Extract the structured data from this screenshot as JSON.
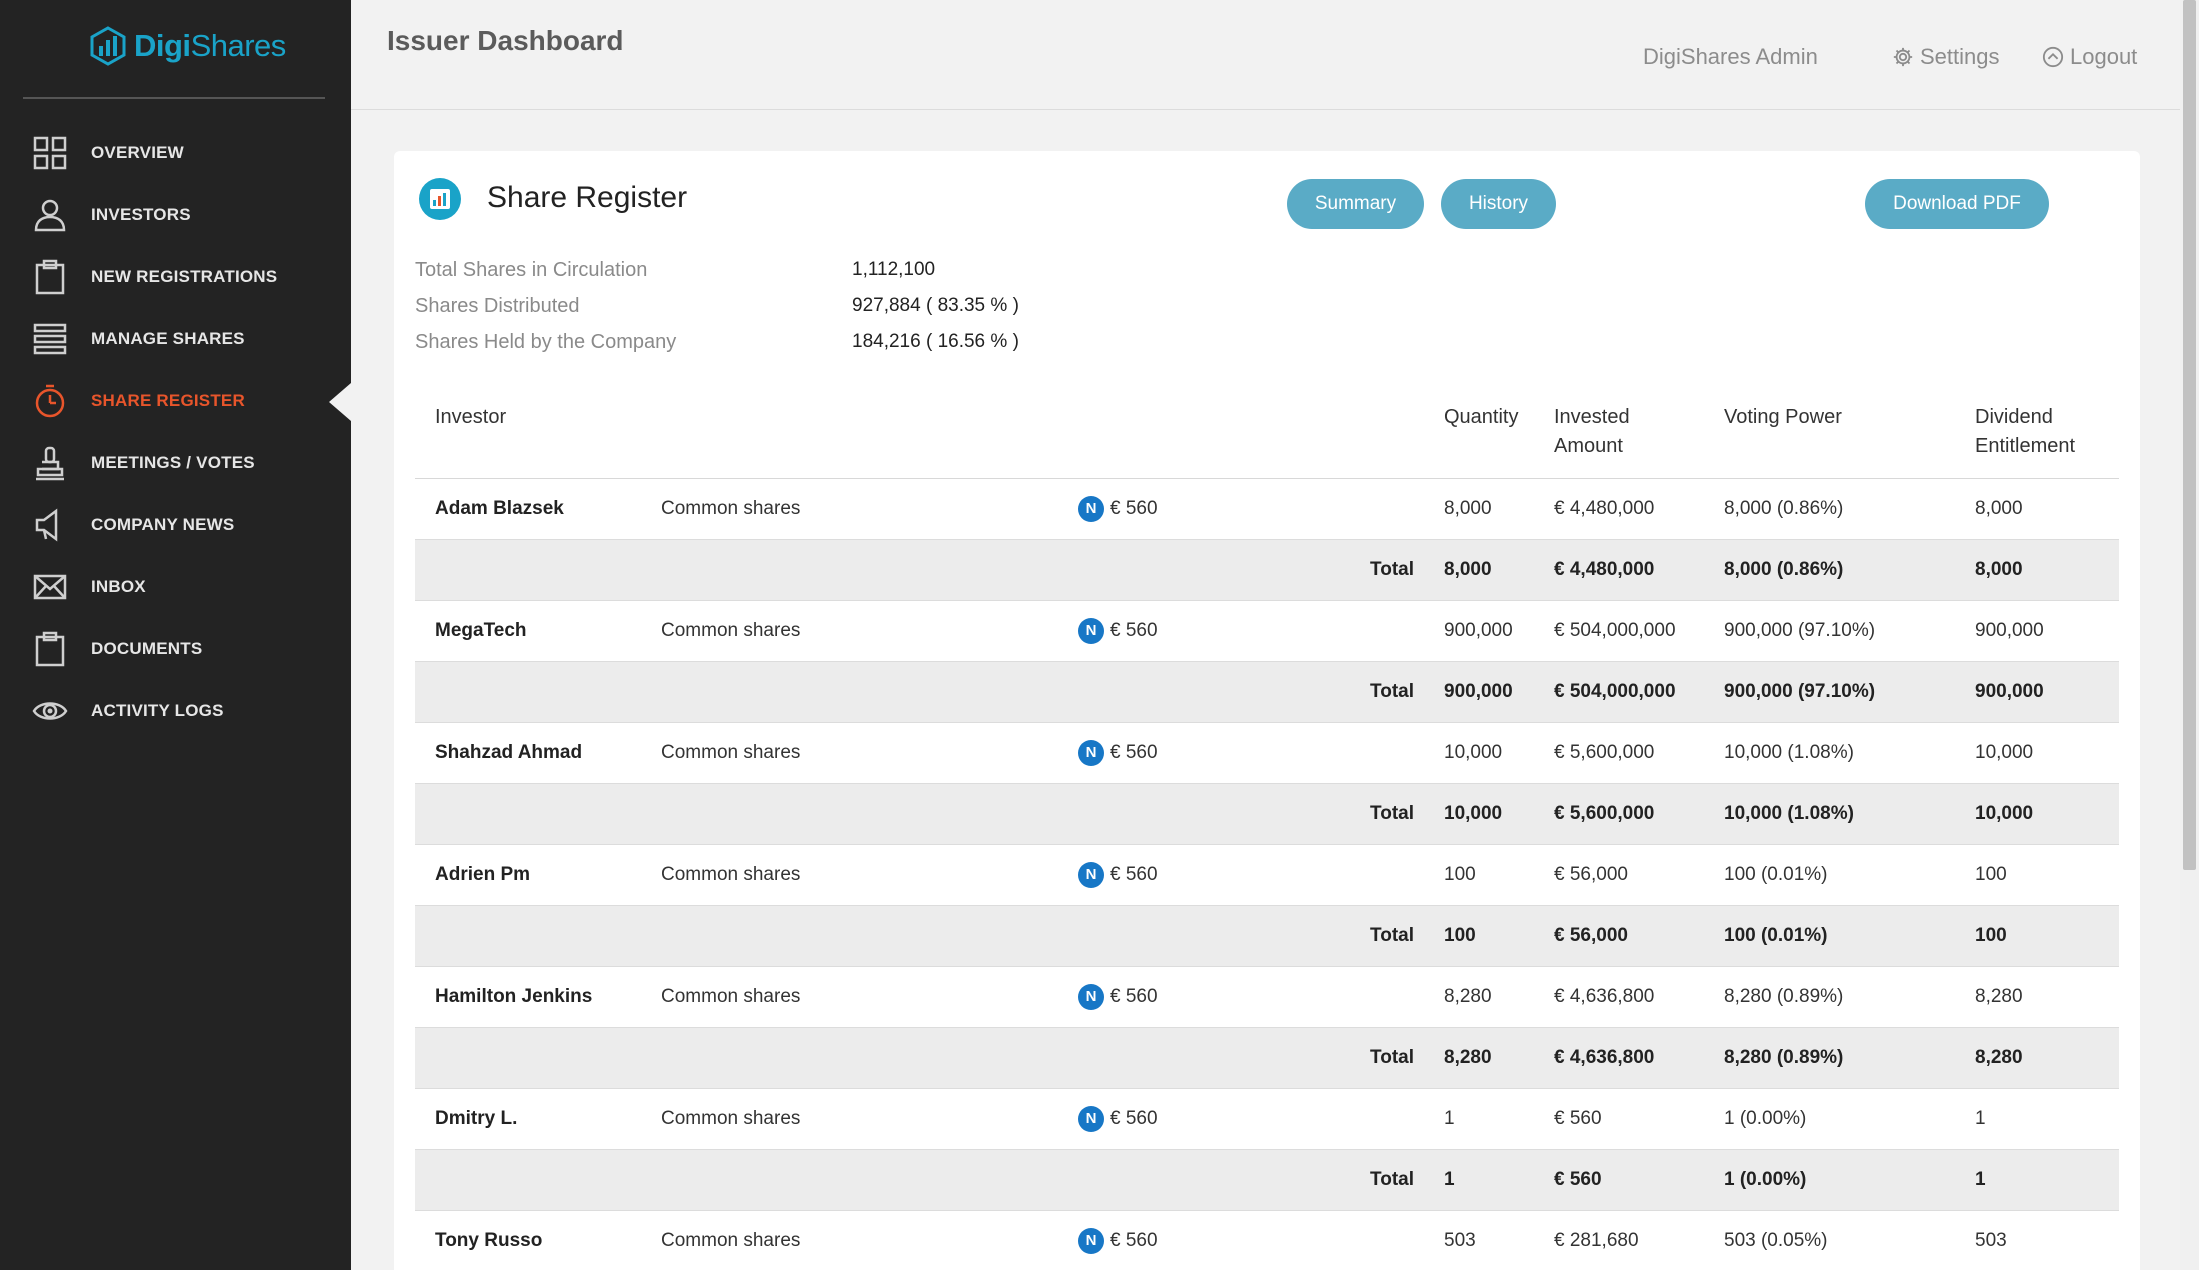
{
  "brand": {
    "name_bold": "Digi",
    "name_light": "Shares"
  },
  "sidebar": {
    "items": [
      {
        "label": "OVERVIEW",
        "icon": "grid-icon"
      },
      {
        "label": "INVESTORS",
        "icon": "user-icon"
      },
      {
        "label": "NEW REGISTRATIONS",
        "icon": "clipboard-icon"
      },
      {
        "label": "MANAGE SHARES",
        "icon": "stack-icon"
      },
      {
        "label": "SHARE REGISTER",
        "icon": "stopwatch-icon",
        "active": true
      },
      {
        "label": "MEETINGS / VOTES",
        "icon": "stamp-icon"
      },
      {
        "label": "COMPANY NEWS",
        "icon": "megaphone-icon"
      },
      {
        "label": "INBOX",
        "icon": "envelope-icon"
      },
      {
        "label": "DOCUMENTS",
        "icon": "clipboard-icon"
      },
      {
        "label": "ACTIVITY LOGS",
        "icon": "eye-icon"
      }
    ]
  },
  "header": {
    "title": "Issuer Dashboard",
    "admin": "DigiShares Admin",
    "settings": "Settings",
    "logout": "Logout"
  },
  "card": {
    "title": "Share Register",
    "summary_button": "Summary",
    "history_button": "History",
    "pdf_button": "Download PDF",
    "stats": [
      {
        "label": "Total Shares in Circulation",
        "value": "1,112,100"
      },
      {
        "label": "Shares Distributed",
        "value": "927,884  ( 83.35 % )"
      },
      {
        "label": "Shares Held by the Company",
        "value": "184,216  ( 16.56 % )"
      }
    ]
  },
  "table": {
    "headers": {
      "investor": "Investor",
      "quantity": "Quantity",
      "invested_1": "Invested",
      "invested_2": "Amount",
      "voting": "Voting Power",
      "dividend_1": "Dividend",
      "dividend_2": "Entitlement"
    },
    "total_label": "Total",
    "badge": "N",
    "rows": [
      {
        "name": "Adam Blazsek",
        "class": "Common shares",
        "price": "€ 560",
        "qty": "8,000",
        "invested": "€ 4,480,000",
        "voting": "8,000 (0.86%)",
        "dividend": "8,000"
      },
      {
        "name": "MegaTech",
        "class": "Common shares",
        "price": "€ 560",
        "qty": "900,000",
        "invested": "€ 504,000,000",
        "voting": "900,000 (97.10%)",
        "dividend": "900,000"
      },
      {
        "name": "Shahzad Ahmad",
        "class": "Common shares",
        "price": "€ 560",
        "qty": "10,000",
        "invested": "€ 5,600,000",
        "voting": "10,000 (1.08%)",
        "dividend": "10,000"
      },
      {
        "name": "Adrien Pm",
        "class": "Common shares",
        "price": "€ 560",
        "qty": "100",
        "invested": "€ 56,000",
        "voting": "100 (0.01%)",
        "dividend": "100"
      },
      {
        "name": "Hamilton Jenkins",
        "class": "Common shares",
        "price": "€ 560",
        "qty": "8,280",
        "invested": "€ 4,636,800",
        "voting": "8,280 (0.89%)",
        "dividend": "8,280"
      },
      {
        "name": "Dmitry L.",
        "class": "Common shares",
        "price": "€ 560",
        "qty": "1",
        "invested": "€ 560",
        "voting": "1 (0.00%)",
        "dividend": "1"
      },
      {
        "name": "Tony Russo",
        "class": "Common shares",
        "price": "€ 560",
        "qty": "503",
        "invested": "€ 281,680",
        "voting": "503 (0.05%)",
        "dividend": "503"
      }
    ]
  },
  "colors": {
    "accent": "#1aa3c8",
    "active_nav": "#e8552b",
    "button": "#5aabc6",
    "sidebar": "#232323"
  }
}
